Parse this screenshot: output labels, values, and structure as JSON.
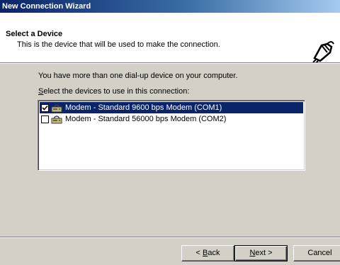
{
  "window": {
    "title": "New Connection Wizard"
  },
  "header": {
    "title": "Select a Device",
    "subtitle": "This is the device that will be used to make the connection.",
    "icon": "telephone-connector-icon"
  },
  "body": {
    "intro": "You have more than one dial-up device on your computer.",
    "instruction_mnemonic": "S",
    "instruction_rest": "elect the devices to use in this connection:"
  },
  "devices": [
    {
      "label": "Modem - Standard  9600 bps Modem (COM1)",
      "checked": true,
      "selected": true
    },
    {
      "label": "Modem - Standard 56000 bps Modem (COM2)",
      "checked": false,
      "selected": false
    }
  ],
  "buttons": {
    "back_prefix": "< ",
    "back_mnemonic": "B",
    "back_rest": "ack",
    "next_mnemonic": "N",
    "next_rest": "ext >",
    "cancel": "Cancel"
  },
  "colors": {
    "title_gradient_start": "#0a246a",
    "title_gradient_end": "#a6caf0",
    "selection": "#0a246a",
    "face": "#d4d0c8"
  }
}
